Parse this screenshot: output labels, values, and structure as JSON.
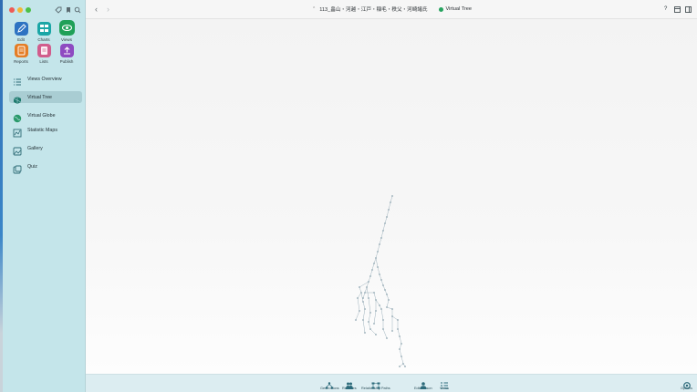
{
  "window": {
    "title": "113_畠山・河越・江戸・稲毛・秩父・河崎諸氏",
    "view_name": "Virtual Tree",
    "colors": {
      "sidebar": "#c4e5ea",
      "accent_green": "#27a35f",
      "tree_lines": "#9fb3bd"
    }
  },
  "toolbar": {
    "tools": [
      {
        "label": "Edit",
        "icon": "pencil-icon",
        "color": "#2d73c2"
      },
      {
        "label": "Charts",
        "icon": "charts-icon",
        "color": "#1aa6a6"
      },
      {
        "label": "Views",
        "icon": "eye-icon",
        "color": "#20a058"
      },
      {
        "label": "Reports",
        "icon": "reports-icon",
        "color": "#e47d25"
      },
      {
        "label": "Lists",
        "icon": "lists-icon",
        "color": "#d15c8c"
      },
      {
        "label": "Publish",
        "icon": "publish-icon",
        "color": "#8e4bc1"
      }
    ]
  },
  "sidebar": {
    "items": [
      {
        "label": "Views Overview",
        "icon": "views-overview-icon"
      },
      {
        "label": "Virtual Tree",
        "icon": "virtual-tree-icon",
        "active": true
      },
      {
        "label": "Virtual Globe",
        "icon": "virtual-globe-icon"
      },
      {
        "label": "Statistic Maps",
        "icon": "statistic-maps-icon"
      },
      {
        "label": "Gallery",
        "icon": "gallery-icon"
      },
      {
        "label": "Quiz",
        "icon": "quiz-icon"
      }
    ]
  },
  "bottom_bar": {
    "buttons": [
      {
        "label": "Generations",
        "icon": "generations-icon"
      },
      {
        "label": "Relatives",
        "icon": "relatives-icon"
      },
      {
        "label": "Relationship Paths",
        "icon": "relationship-paths-icon"
      },
      {
        "label": "Edit Person",
        "icon": "edit-person-icon"
      },
      {
        "label": "Views",
        "icon": "views-icon"
      },
      {
        "label": "Options",
        "icon": "options-icon"
      }
    ]
  }
}
